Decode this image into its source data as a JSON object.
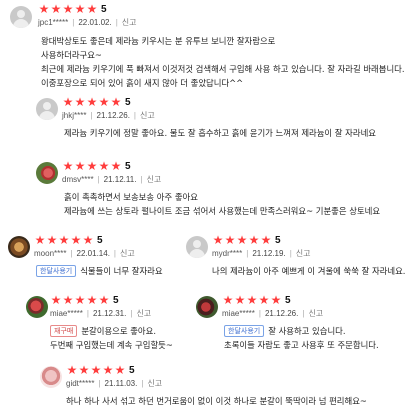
{
  "reviews": [
    {
      "score": "5",
      "user": "jpc1*****",
      "date": "22.01.02.",
      "report": "신고",
      "lines": [
        "왕대박상토도 좋은데 제라늄 키우시는 분 유투브 보니깐 잘자람으로",
        "사용하더라구요~",
        "최근에 제라늄 키우기에 푹 빠져서 이것저것 검색해서 구입해 사용 하고 있습니다. 잘 자라길 바래봅니다.",
        "이중포장으로 되어 있어 흙이 새지 않아 더 좋았답니다^^"
      ]
    },
    {
      "score": "5",
      "user": "jhkj****",
      "date": "21.12.26.",
      "report": "신고",
      "lines": [
        "제라늄 키우기에 정말 좋아요. 물도 잘 흡수하고 흙에 윤기가 느껴져 제라늄이 잘 자라네요"
      ]
    },
    {
      "score": "5",
      "user": "dmsv****",
      "date": "21.12.11.",
      "report": "신고",
      "lines": [
        "흙이  촉촉하면서 보송보송 아주 좋아요",
        "제라늄에 쓰는 상토라 펄나이트 조금 섞어서 사용했는데 만족스러워요~ 기분좋은 상토네요"
      ]
    },
    {
      "score": "5",
      "user": "moon****",
      "date": "22.01.14.",
      "report": "신고",
      "badge": "한달사용기",
      "lines": [
        "식물들이 너무 잘자라요"
      ]
    },
    {
      "score": "5",
      "user": "mydr****",
      "date": "21.12.19.",
      "report": "신고",
      "lines": [
        "나의 제라늄이 아주 예쁘게 이 겨울에 쑥쑥 잘 자라네요."
      ]
    },
    {
      "score": "5",
      "user": "miae*****",
      "date": "21.12.31.",
      "report": "신고",
      "badge": "재구매",
      "lines": [
        "분갈이용으로 좋아요.",
        "두번째 구입했는데 계속 구입할듯~"
      ]
    },
    {
      "score": "5",
      "user": "miae*****",
      "date": "21.12.26.",
      "report": "신고",
      "badge": "한달사용기",
      "lines": [
        "잘 사용하고 있습니다.",
        "초록이들 자람도 좋고 사용후 또 주문합니다."
      ]
    },
    {
      "score": "5",
      "user": "gidt*****",
      "date": "21.11.03.",
      "report": "신고",
      "lines": [
        "하나 하나 사서 섞고 하던 번거로움이 없이 이것 하나로 분갈이 뚝딱이라 넘 편리해요~"
      ]
    }
  ],
  "colors": {
    "star": "#ff3d3d",
    "badge_blue": "#3f6fd0",
    "badge_red": "#d04a4a"
  },
  "icons": {
    "star": "star-icon",
    "avatar_default": "default-avatar-icon"
  }
}
